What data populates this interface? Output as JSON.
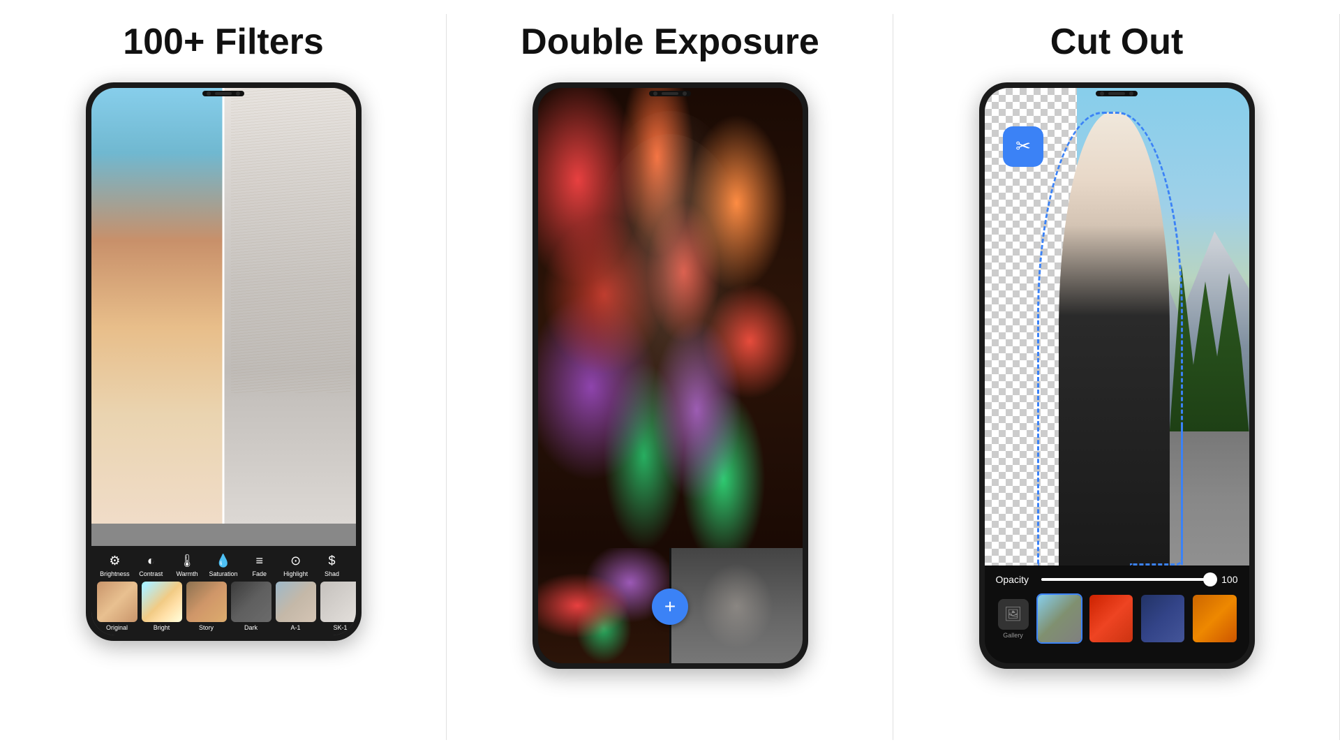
{
  "sections": [
    {
      "id": "filters",
      "title": "100+ Filters",
      "toolbar_items": [
        {
          "label": "Brightness",
          "icon": "☀"
        },
        {
          "label": "Contrast",
          "icon": "◐"
        },
        {
          "label": "Warmth",
          "icon": "🌡"
        },
        {
          "label": "Saturation",
          "icon": "💧"
        },
        {
          "label": "Fade",
          "icon": "≡"
        },
        {
          "label": "Highlight",
          "icon": "⊙"
        },
        {
          "label": "Shad",
          "icon": "$"
        }
      ],
      "filter_thumbs": [
        {
          "label": "Original",
          "class": "thumb-original"
        },
        {
          "label": "Bright",
          "class": "thumb-bright"
        },
        {
          "label": "Story",
          "class": "thumb-story"
        },
        {
          "label": "Dark",
          "class": "thumb-dark"
        },
        {
          "label": "A-1",
          "class": "thumb-a1"
        },
        {
          "label": "SK-1",
          "class": "thumb-sk1"
        }
      ]
    },
    {
      "id": "double_exposure",
      "title": "Double Exposure",
      "add_btn_label": "+"
    },
    {
      "id": "cutout",
      "title": "Cut Out",
      "opacity_label": "Opacity",
      "opacity_value": "100",
      "gallery_label": "Gallery",
      "cut_icon": "✂"
    }
  ]
}
